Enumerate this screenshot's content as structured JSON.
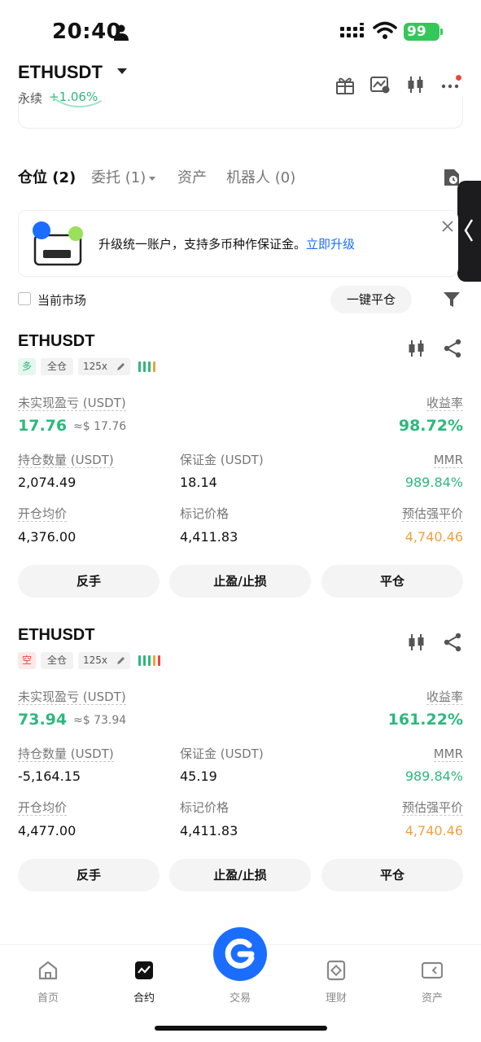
{
  "status_bar": {
    "time": "20:40",
    "battery": "99"
  },
  "header": {
    "symbol": "ETHUSDT",
    "contract_type": "永续",
    "change": "+1.06%"
  },
  "tabs": [
    {
      "label": "仓位 (2)"
    },
    {
      "label": "委托 (1)"
    },
    {
      "label": "资产"
    },
    {
      "label": "机器人 (0)"
    }
  ],
  "banner": {
    "text": "升级统一账户，支持多币种作保证金。",
    "link": "立即升级"
  },
  "filter": {
    "current_market": "当前市场",
    "close_all": "一键平仓"
  },
  "labels": {
    "unrealized_pnl": "未实现盈亏 (USDT)",
    "roe": "收益率",
    "size": "持仓数量 (USDT)",
    "margin": "保证金 (USDT)",
    "mmr": "MMR",
    "entry_price": "开仓均价",
    "mark_price": "标记价格",
    "liq_price": "预估强平价"
  },
  "positions": [
    {
      "symbol": "ETHUSDT",
      "side": "多",
      "margin_mode": "全仓",
      "leverage": "125x",
      "adl_colors": [
        "#2db87d",
        "#2db87d",
        "#2db87d",
        "#f0a040"
      ],
      "pnl": "17.76",
      "pnl_usd": "≈$ 17.76",
      "roe": "98.72%",
      "size": "2,074.49",
      "margin": "18.14",
      "mmr": "989.84%",
      "entry_price": "4,376.00",
      "mark_price": "4,411.83",
      "liq_price": "4,740.46",
      "actions": {
        "reverse": "反手",
        "tpsl": "止盈/止损",
        "close": "平仓"
      }
    },
    {
      "symbol": "ETHUSDT",
      "side": "空",
      "margin_mode": "全仓",
      "leverage": "125x",
      "adl_colors": [
        "#2db87d",
        "#2db87d",
        "#2db87d",
        "#f0a040",
        "#f0453a"
      ],
      "pnl": "73.94",
      "pnl_usd": "≈$ 73.94",
      "roe": "161.22%",
      "size": "-5,164.15",
      "margin": "45.19",
      "mmr": "989.84%",
      "entry_price": "4,477.00",
      "mark_price": "4,411.83",
      "liq_price": "4,740.46",
      "actions": {
        "reverse": "反手",
        "tpsl": "止盈/止损",
        "close": "平仓"
      }
    }
  ],
  "bottom_nav": [
    {
      "label": "首页",
      "icon": "home-icon"
    },
    {
      "label": "合约",
      "icon": "futures-icon"
    },
    {
      "label": "交易",
      "icon": "trade-icon"
    },
    {
      "label": "理财",
      "icon": "earn-icon"
    },
    {
      "label": "资产",
      "icon": "wallet-icon"
    }
  ]
}
